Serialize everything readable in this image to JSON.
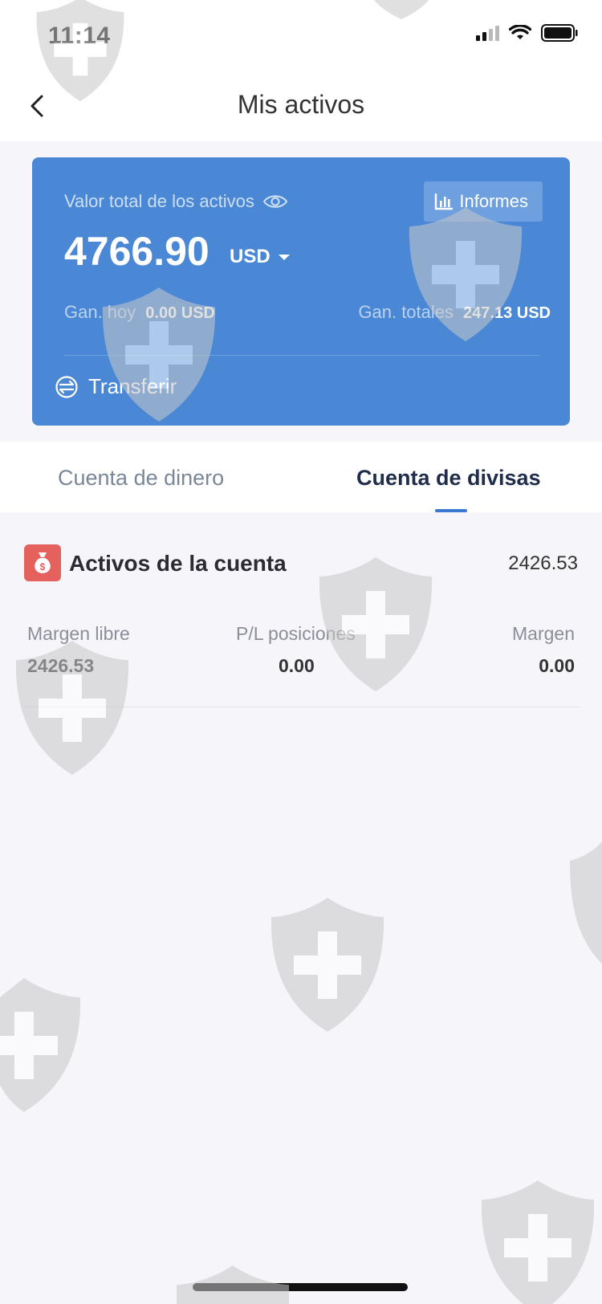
{
  "status_bar": {
    "time": "11:14"
  },
  "header": {
    "title": "Mis activos"
  },
  "summary": {
    "total_label": "Valor total de los activos",
    "reports_label": "Informes",
    "total_value": "4766.90",
    "currency": "USD",
    "gain_today_label": "Gan. hoy",
    "gain_today_value": "0.00 USD",
    "gain_total_label": "Gan. totales",
    "gain_total_value": "247.13 USD",
    "transfer_label": "Transferir"
  },
  "tabs": [
    {
      "label": "Cuenta de dinero",
      "active": false
    },
    {
      "label": "Cuenta de divisas",
      "active": true
    }
  ],
  "account": {
    "title": "Activos de la cuenta",
    "total": "2426.53",
    "metrics": [
      {
        "label": "Margen libre",
        "value": "2426.53"
      },
      {
        "label": "P/L posiciones",
        "value": "0.00"
      },
      {
        "label": "Margen",
        "value": "0.00"
      }
    ]
  },
  "colors": {
    "card": "#4a88d6",
    "accent": "#3a7ad0",
    "account_icon": "#e4615e",
    "background": "#f5f5fa"
  },
  "icons": [
    "back-chevron-icon",
    "signal-icon",
    "wifi-icon",
    "battery-icon",
    "eye-icon",
    "bar-chart-icon",
    "transfer-icon",
    "money-bag-icon",
    "shield-cross-watermark"
  ]
}
